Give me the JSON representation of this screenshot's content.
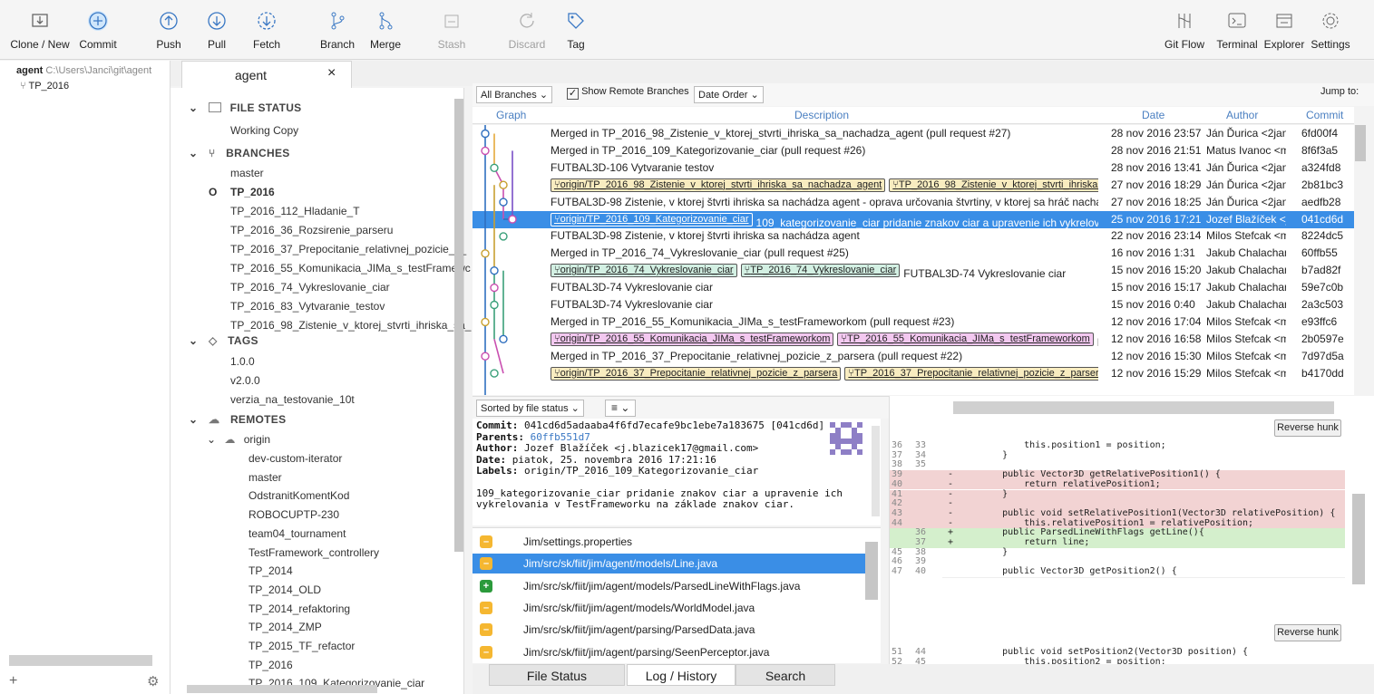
{
  "toolbar": {
    "left": [
      {
        "label": "Clone / New",
        "icon": "clone-icon"
      },
      {
        "label": "Commit",
        "icon": "commit-icon"
      },
      {
        "label": "Push",
        "icon": "push-icon"
      },
      {
        "label": "Pull",
        "icon": "pull-icon"
      },
      {
        "label": "Fetch",
        "icon": "fetch-icon"
      },
      {
        "label": "Branch",
        "icon": "branch-icon"
      },
      {
        "label": "Merge",
        "icon": "merge-icon"
      },
      {
        "label": "Stash",
        "icon": "stash-icon"
      },
      {
        "label": "Discard",
        "icon": "discard-icon"
      },
      {
        "label": "Tag",
        "icon": "tag-icon"
      }
    ],
    "right": [
      {
        "label": "Git Flow",
        "icon": "git-flow-icon"
      },
      {
        "label": "Terminal",
        "icon": "terminal-icon"
      },
      {
        "label": "Explorer",
        "icon": "explorer-icon"
      },
      {
        "label": "Settings",
        "icon": "settings-icon"
      }
    ]
  },
  "repo_list": {
    "repo_name": "agent",
    "repo_path": "C:\\Users\\Janci\\git\\agent",
    "branch": "TP_2016"
  },
  "tab": {
    "title": "agent",
    "close": "×"
  },
  "sidebar": {
    "file_status": {
      "header": "FILE STATUS",
      "items": [
        "Working Copy"
      ]
    },
    "branches": {
      "header": "BRANCHES",
      "items": [
        "master",
        "TP_2016",
        "TP_2016_112_Hladanie_T",
        "TP_2016_36_Rozsirenie_parseru",
        "TP_2016_37_Prepocitanie_relativnej_pozicie_z_",
        "TP_2016_55_Komunikacia_JIMa_s_testFramewc",
        "TP_2016_74_Vykreslovanie_ciar",
        "TP_2016_83_Vytvaranie_testov",
        "TP_2016_98_Zistenie_v_ktorej_stvrti_ihriska_sa_"
      ],
      "current_marker": "O"
    },
    "tags": {
      "header": "TAGS",
      "items": [
        "1.0.0",
        "v2.0.0",
        "verzia_na_testovanie_10t"
      ]
    },
    "remotes": {
      "header": "REMOTES",
      "origin": "origin",
      "items": [
        "dev-custom-iterator",
        "master",
        "OdstranitKomentKod",
        "ROBOCUPTP-230",
        "team04_tournament",
        "TestFramework_controllery",
        "TP_2014",
        "TP_2014_OLD",
        "TP_2014_refaktoring",
        "TP_2014_ZMP",
        "TP_2015_TF_refactor",
        "TP_2016",
        "TP_2016_109_Kategorizovanie_ciar"
      ]
    },
    "add": "+"
  },
  "log": {
    "branches_filter": "All Branches",
    "show_remote": "Show Remote Branches",
    "order": "Date Order",
    "jump_to": "Jump to:",
    "columns": {
      "graph": "Graph",
      "description": "Description",
      "date": "Date",
      "author": "Author",
      "commit": "Commit"
    },
    "rows": [
      {
        "labels": [],
        "desc": "Merged in TP_2016_98_Zistenie_v_ktorej_stvrti_ihriska_sa_nachadza_agent (pull request #27)",
        "date": "28 nov 2016 23:57",
        "author": "Ján Ďurica <2janci.",
        "commit": "6fd00f4"
      },
      {
        "labels": [],
        "desc": "Merged in TP_2016_109_Kategorizovanie_ciar (pull request #26)",
        "date": "28 nov 2016 21:51",
        "author": "Matus Ivanoc <ma",
        "commit": "8f6f3a5"
      },
      {
        "labels": [],
        "desc": "FUTBAL3D-106 Vytvaranie testov",
        "date": "28 nov 2016 13:41",
        "author": "Ján Ďurica <2janci.",
        "commit": "a324fd8"
      },
      {
        "labels": [
          "origin/TP_2016_98_Zistenie_v_ktorej_stvrti_ihriska_sa_nachadza_agent",
          "TP_2016_98_Zistenie_v_ktorej_stvrti_ihriska_sa"
        ],
        "label_color": "#f8ecc0",
        "desc": "",
        "date": "27 nov 2016 18:29",
        "author": "Ján Ďurica <2janci.",
        "commit": "2b81bc3"
      },
      {
        "labels": [],
        "desc": "FUTBAL3D-98 Zistenie, v ktorej štvrti ihriska sa nachádza agent - oprava určovania štvrtiny, v ktorej sa hráč nachádza",
        "date": "27 nov 2016 18:25",
        "author": "Ján Ďurica <2janci.",
        "commit": "aedfb28"
      },
      {
        "labels": [
          "origin/TP_2016_109_Kategorizovanie_ciar"
        ],
        "label_color": "#3a8ee6",
        "desc": "109_kategorizovanie_ciar pridanie znakov ciar a upravenie ich vykrelovar",
        "date": "25 nov 2016 17:21",
        "author": "Jozef Blažíček <j.b",
        "commit": "041cd6d",
        "selected": true
      },
      {
        "labels": [],
        "desc": "FUTBAL3D-98 Zistenie, v ktorej štvrti ihriska sa nachádza agent",
        "date": "22 nov 2016 23:14",
        "author": "Milos Stefcak <mil",
        "commit": "8224dc5"
      },
      {
        "labels": [],
        "desc": "Merged in TP_2016_74_Vykreslovanie_ciar (pull request #25)",
        "date": "16 nov 2016 1:31",
        "author": "Jakub Chalachan <",
        "commit": "60ffb55"
      },
      {
        "labels": [
          "origin/TP_2016_74_Vykreslovanie_ciar",
          "TP_2016_74_Vykreslovanie_ciar"
        ],
        "label_color": "#d3f0e3",
        "desc": "FUTBAL3D-74 Vykreslovanie ciar",
        "date": "15 nov 2016 15:20",
        "author": "Jakub Chalachan <",
        "commit": "b7ad82f"
      },
      {
        "labels": [],
        "desc": "FUTBAL3D-74 Vykreslovanie ciar",
        "date": "15 nov 2016 15:17",
        "author": "Jakub Chalachan <",
        "commit": "59e7c0b"
      },
      {
        "labels": [],
        "desc": "FUTBAL3D-74 Vykreslovanie ciar",
        "date": "15 nov 2016 0:40",
        "author": "Jakub Chalachan <",
        "commit": "2a3c503"
      },
      {
        "labels": [],
        "desc": "Merged in TP_2016_55_Komunikacia_JIMa_s_testFrameworkom (pull request #23)",
        "date": "12 nov 2016 17:04",
        "author": "Milos Stefcak <mil",
        "commit": "e93ffc6"
      },
      {
        "labels": [
          "origin/TP_2016_55_Komunikacia_JIMa_s_testFrameworkom",
          "TP_2016_55_Komunikacia_JIMa_s_testFrameworkom"
        ],
        "label_color": "#f3c8f0",
        "desc": "F",
        "date": "12 nov 2016 16:58",
        "author": "Milos Stefcak <mil",
        "commit": "2b0597e"
      },
      {
        "labels": [],
        "desc": "Merged in TP_2016_37_Prepocitanie_relativnej_pozicie_z_parsera (pull request #22)",
        "date": "12 nov 2016 15:30",
        "author": "Milos Stefcak <mil",
        "commit": "7d97d5a"
      },
      {
        "labels": [
          "origin/TP_2016_37_Prepocitanie_relativnej_pozicie_z_parsera",
          "TP_2016_37_Prepocitanie_relativnej_pozicie_z_parsera"
        ],
        "label_color": "#f8ecc0",
        "desc": "",
        "date": "12 nov 2016 15:29",
        "author": "Milos Stefcak <mil",
        "commit": "b4170dd"
      }
    ]
  },
  "details": {
    "sort": "Sorted by file status",
    "search_placeholder": "Search",
    "commit_label": "Commit:",
    "commit_value": "041cd6d5adaaba4f6fd7ecafe9bc1ebe7a183675 [041cd6d]",
    "parents_label": "Parents:",
    "parents_value": "60ffb551d7",
    "author_label": "Author:",
    "author_value": "Jozef Blažíček <j.blazicek17@gmail.com>",
    "date_label": "Date:",
    "date_value": "piatok, 25. novembra 2016 17:21:16",
    "labels_label": "Labels:",
    "labels_value": "origin/TP_2016_109_Kategorizovanie_ciar",
    "message": "109_kategorizovanie_ciar pridanie znakov ciar a upravenie ich vykrelovania v TestFrameworku na základe znakov ciar."
  },
  "files": [
    {
      "path": "Jim/settings.properties",
      "status": "modified"
    },
    {
      "path": "Jim/src/sk/fiit/jim/agent/models/Line.java",
      "status": "modified",
      "selected": true
    },
    {
      "path": "Jim/src/sk/fiit/jim/agent/models/ParsedLineWithFlags.java",
      "status": "added"
    },
    {
      "path": "Jim/src/sk/fiit/jim/agent/models/WorldModel.java",
      "status": "modified"
    },
    {
      "path": "Jim/src/sk/fiit/jim/agent/parsing/ParsedData.java",
      "status": "modified"
    },
    {
      "path": "Jim/src/sk/fiit/jim/agent/parsing/SeenPerceptor.java",
      "status": "modified"
    }
  ],
  "diff": {
    "reverse_hunk": "Reverse hunk",
    "lines": [
      {
        "o": "36",
        "n": "33",
        "s": "",
        "t": "        this.position1 = position;",
        "k": ""
      },
      {
        "o": "37",
        "n": "34",
        "s": "",
        "t": "    }",
        "k": ""
      },
      {
        "o": "38",
        "n": "35",
        "s": "",
        "t": "",
        "k": ""
      },
      {
        "o": "39",
        "n": "",
        "s": "-",
        "t": "    public Vector3D getRelativePosition1() {",
        "k": "del"
      },
      {
        "o": "40",
        "n": "",
        "s": "-",
        "t": "        return relativePosition1;",
        "k": "del"
      },
      {
        "o": "41",
        "n": "",
        "s": "-",
        "t": "    }",
        "k": "del"
      },
      {
        "o": "42",
        "n": "",
        "s": "-",
        "t": "",
        "k": "del"
      },
      {
        "o": "43",
        "n": "",
        "s": "-",
        "t": "    public void setRelativePosition1(Vector3D relativePosition) {",
        "k": "del"
      },
      {
        "o": "44",
        "n": "",
        "s": "-",
        "t": "        this.relativePosition1 = relativePosition;",
        "k": "del"
      },
      {
        "o": "",
        "n": "36",
        "s": "+",
        "t": "    public ParsedLineWithFlags getLine(){",
        "k": "ins"
      },
      {
        "o": "",
        "n": "37",
        "s": "+",
        "t": "        return line;",
        "k": "ins"
      },
      {
        "o": "45",
        "n": "38",
        "s": "",
        "t": "    }",
        "k": ""
      },
      {
        "o": "46",
        "n": "39",
        "s": "",
        "t": "",
        "k": ""
      },
      {
        "o": "47",
        "n": "40",
        "s": "",
        "t": "    public Vector3D getPosition2() {",
        "k": ""
      }
    ],
    "lines2": [
      {
        "o": "51",
        "n": "44",
        "s": "",
        "t": "    public void setPosition2(Vector3D position) {",
        "k": ""
      },
      {
        "o": "52",
        "n": "45",
        "s": "",
        "t": "        this.position2 = position;",
        "k": ""
      }
    ]
  },
  "bottom_tabs": [
    "File Status",
    "Log / History",
    "Search"
  ],
  "colors": {
    "accent": "#3a8ee6",
    "del": "#f2d3d3",
    "ins": "#d4efcc"
  }
}
